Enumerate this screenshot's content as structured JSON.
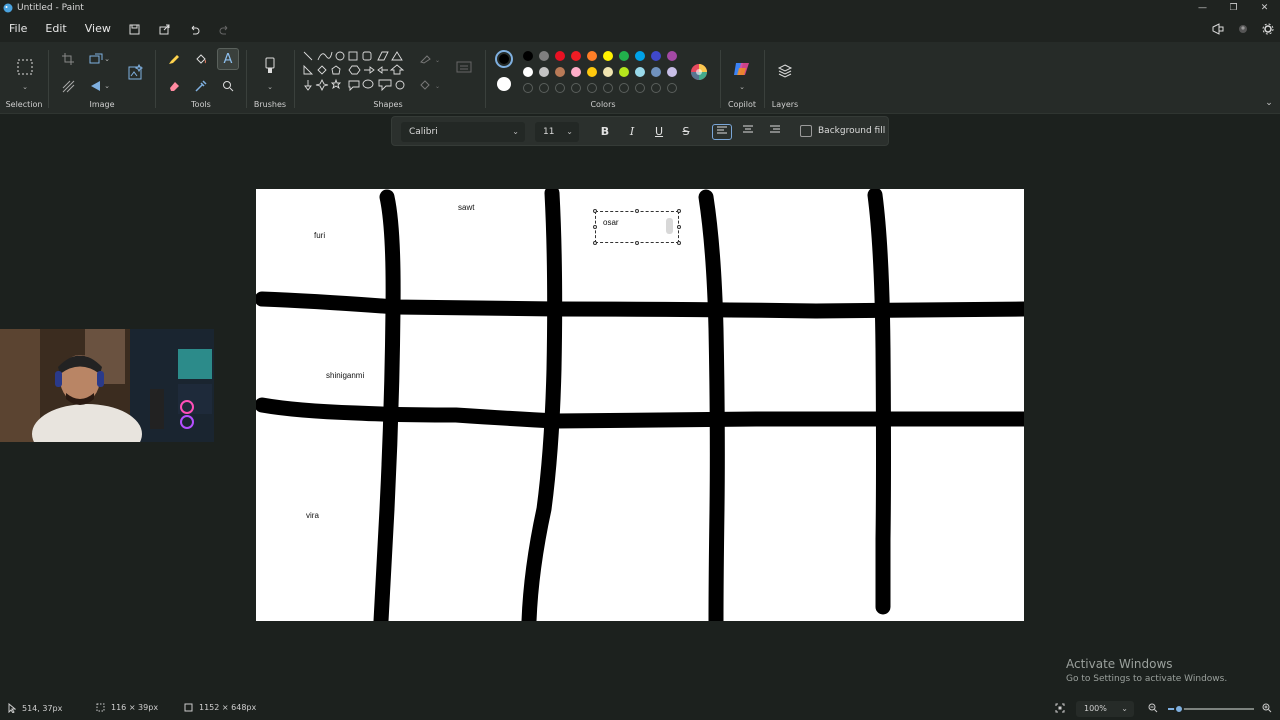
{
  "window": {
    "title": "Untitled - Paint"
  },
  "menu": {
    "file": "File",
    "edit": "Edit",
    "view": "View"
  },
  "ribbon": {
    "groups": {
      "selection": "Selection",
      "image": "Image",
      "tools": "Tools",
      "brushes": "Brushes",
      "shapes": "Shapes",
      "colors": "Colors",
      "copilot": "Copilot",
      "layers": "Layers"
    },
    "palette": {
      "row1": [
        "#000000",
        "#7f7f7f",
        "#e81123",
        "#ed1c24",
        "#ff7f27",
        "#fff200",
        "#22b14c",
        "#00a2e8",
        "#3f48cc",
        "#a349a4"
      ],
      "row2": [
        "#ffffff",
        "#c3c3c3",
        "#b97a57",
        "#ffaec9",
        "#ffc90e",
        "#efe4b0",
        "#b5e61d",
        "#99d9ea",
        "#7092be",
        "#c8bfe7"
      ],
      "primary": "#000000",
      "secondary": "#ffffff"
    }
  },
  "textbar": {
    "font": "Calibri",
    "size": "11",
    "background_fill_label": "Background fill"
  },
  "canvas": {
    "labels": {
      "furi": "furi",
      "sawt": "sawt",
      "shiniganmi": "shiniganmi",
      "vira": "vira"
    },
    "textbox_value": "osar"
  },
  "watermark": {
    "title": "Activate Windows",
    "subtitle": "Go to Settings to activate Windows."
  },
  "status": {
    "cursor": "514, 37px",
    "selection_size": "116 × 39px",
    "canvas_size": "1152 × 648px",
    "zoom": "100%",
    "zoom_fraction": 0.13
  },
  "colors": {
    "accent": "#7fb0e0",
    "ribbon_bg": "#262b28",
    "app_bg": "#1c211e"
  }
}
